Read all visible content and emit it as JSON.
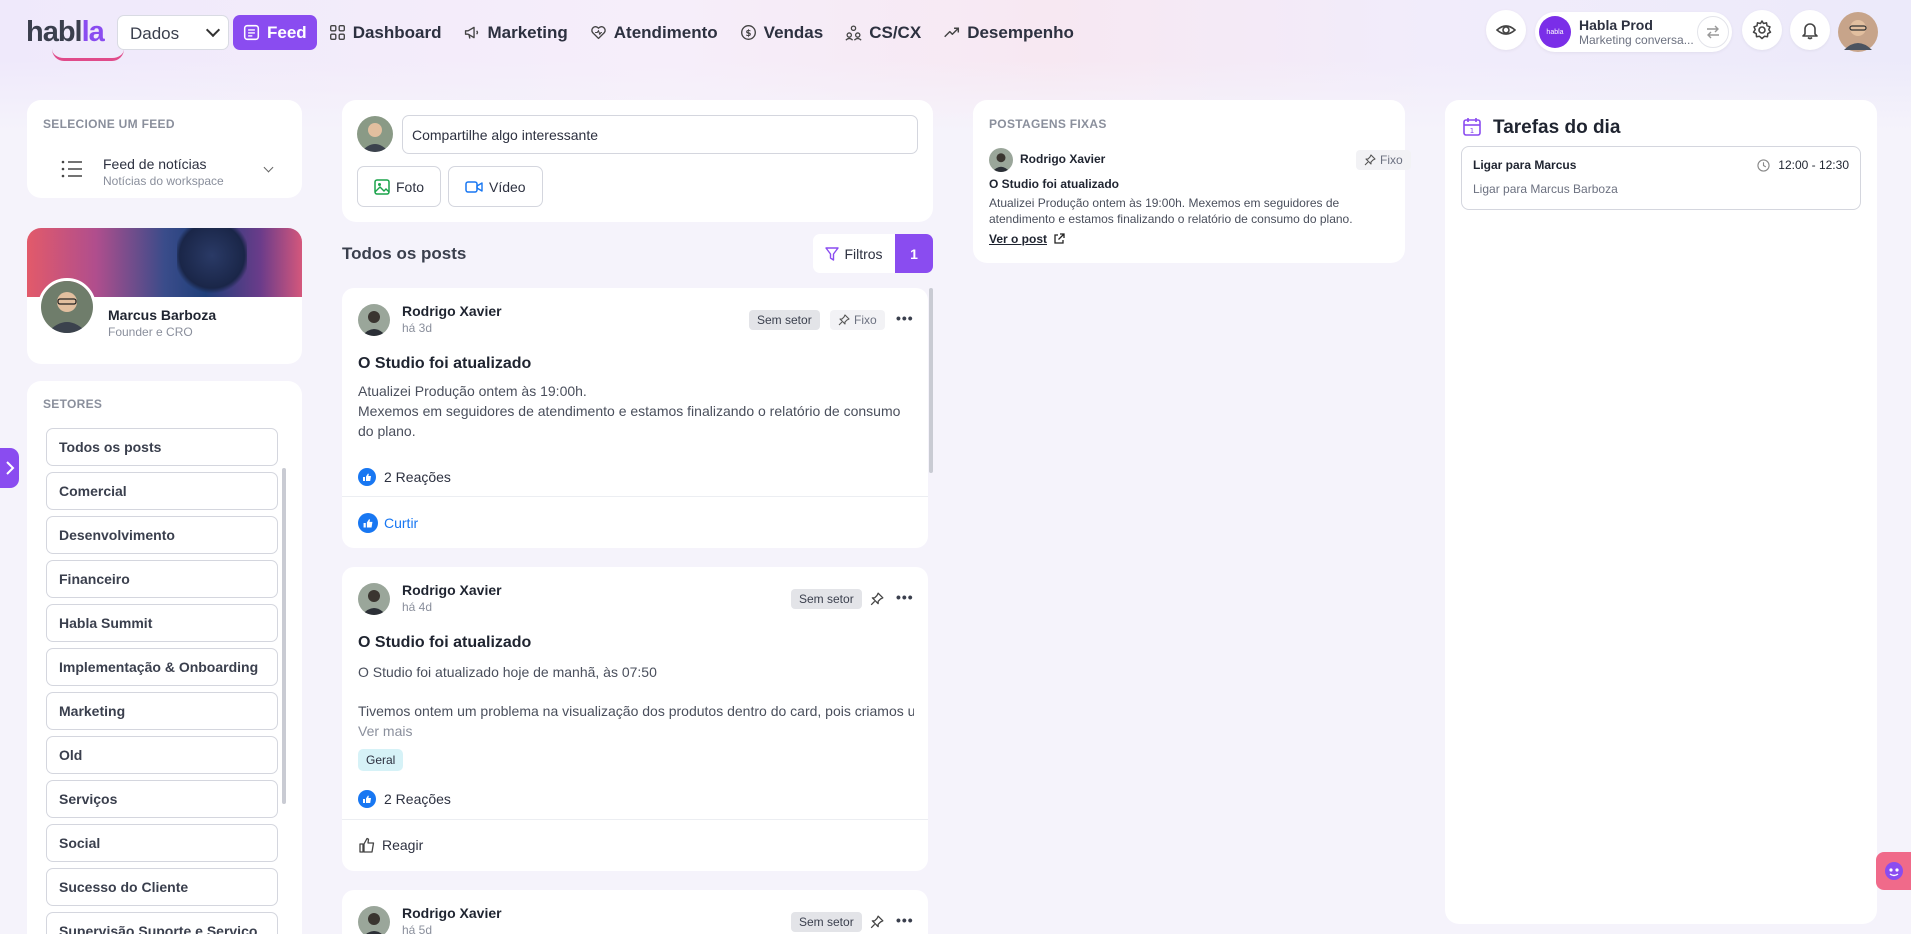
{
  "logo": {
    "text_main": "habl",
    "text_accent": "la"
  },
  "workspace_select": {
    "value": "Dados"
  },
  "nav": [
    {
      "label": "Feed",
      "icon": "feed-icon",
      "active": true
    },
    {
      "label": "Dashboard",
      "icon": "grid-icon"
    },
    {
      "label": "Marketing",
      "icon": "megaphone-icon"
    },
    {
      "label": "Atendimento",
      "icon": "heart-icon"
    },
    {
      "label": "Vendas",
      "icon": "dollar-icon"
    },
    {
      "label": "CS/CX",
      "icon": "users-icon"
    },
    {
      "label": "Desempenho",
      "icon": "trend-icon"
    }
  ],
  "account": {
    "name": "Habla Prod",
    "subtitle": "Marketing conversa...",
    "logo_text": "habla"
  },
  "feed_selector": {
    "heading": "SELECIONE UM FEED",
    "title": "Feed de notícias",
    "subtitle": "Notícias do workspace"
  },
  "profile": {
    "name": "Marcus Barboza",
    "role": "Founder e CRO"
  },
  "sectors": {
    "heading": "SETORES",
    "items": [
      "Todos os posts",
      "Comercial",
      "Desenvolvimento",
      "Financeiro",
      "Habla Summit",
      "Implementação & Onboarding",
      "Marketing",
      "Old",
      "Serviços",
      "Social",
      "Sucesso do Cliente",
      "Supervisão Suporte e Serviço"
    ]
  },
  "composer": {
    "placeholder": "Compartilhe algo interessante",
    "photo_label": "Foto",
    "video_label": "Vídeo"
  },
  "feed": {
    "title": "Todos os posts",
    "filters_label": "Filtros",
    "filters_count": "1"
  },
  "posts": [
    {
      "author": "Rodrigo Xavier",
      "time": "há 3d",
      "sector": "Sem setor",
      "pinned_label": "Fixo",
      "title": "O Studio foi atualizado",
      "body": "Atualizei Produção ontem às 19:00h.\nMexemos em seguidores de atendimento e estamos finalizando o relatório de consumo do plano.",
      "reactions": "2 Reações",
      "action": "Curtir"
    },
    {
      "author": "Rodrigo Xavier",
      "time": "há 4d",
      "sector": "Sem setor",
      "title": "O Studio foi atualizado",
      "body_line1": "O Studio foi atualizado hoje de manhã, às 07:50",
      "body_line2": "Tivemos ontem um problema na visualização dos produtos dentro do card, pois criamos u...",
      "see_more": "Ver mais",
      "tag": "Geral",
      "reactions": "2 Reações",
      "action": "Reagir"
    },
    {
      "author": "Rodrigo Xavier",
      "time": "há 5d",
      "sector": "Sem setor"
    }
  ],
  "pinned": {
    "heading": "POSTAGENS FIXAS",
    "author": "Rodrigo Xavier",
    "fixo_label": "Fixo",
    "title": "O Studio foi atualizado",
    "body": "Atualizei Produção ontem às 19:00h. Mexemos em seguidores de atendimento e estamos finalizando o relatório de consumo do plano.",
    "link": "Ver o post"
  },
  "tasks": {
    "title": "Tarefas do dia",
    "items": [
      {
        "title": "Ligar para Marcus",
        "time": "12:00 - 12:30",
        "subtitle": "Ligar para Marcus Barboza"
      }
    ]
  },
  "colors": {
    "accent": "#8a4cf0",
    "link_blue": "#1877f2",
    "tag_bg": "#d6f2f7"
  }
}
